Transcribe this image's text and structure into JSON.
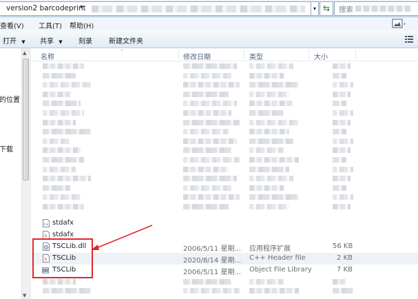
{
  "address": {
    "path": "version2 barcodeprint",
    "separator": "▸"
  },
  "search": {
    "placeholder": "搜索"
  },
  "menu": [
    {
      "label": "查看(V)"
    },
    {
      "label": "工具(T)"
    },
    {
      "label": "帮助(H)"
    }
  ],
  "commands": {
    "open": "打开",
    "share": "共享",
    "burn": "刻录",
    "new_folder": "新建文件夹"
  },
  "nav_items": [
    "的位置",
    "下载"
  ],
  "columns": {
    "name": "名称",
    "date": "修改日期",
    "type": "类型",
    "size": "大小"
  },
  "files": [
    {
      "name": "stdafx",
      "date": "",
      "type": "",
      "size": "",
      "icon": "cpp-source-icon"
    },
    {
      "name": "stdafx",
      "date": "",
      "type": "",
      "size": "",
      "icon": "c-header-icon"
    },
    {
      "name": "TSCLib.dll",
      "date": "2006/5/11 星期...",
      "type": "应用程序扩展",
      "size": "56 KB",
      "icon": "dll-icon"
    },
    {
      "name": "TSCLib",
      "date": "2020/8/14 星期...",
      "type": "C++ Header file",
      "size": "2 KB",
      "icon": "c-header-icon"
    },
    {
      "name": "TSCLib",
      "date": "2006/5/11 星期...",
      "type": "Object File Library",
      "size": "7 KB",
      "icon": "lib-icon"
    }
  ],
  "colors": {
    "annotation": "#e0252a",
    "header_text": "#4d6082",
    "selected_row": "#eef2f7"
  }
}
